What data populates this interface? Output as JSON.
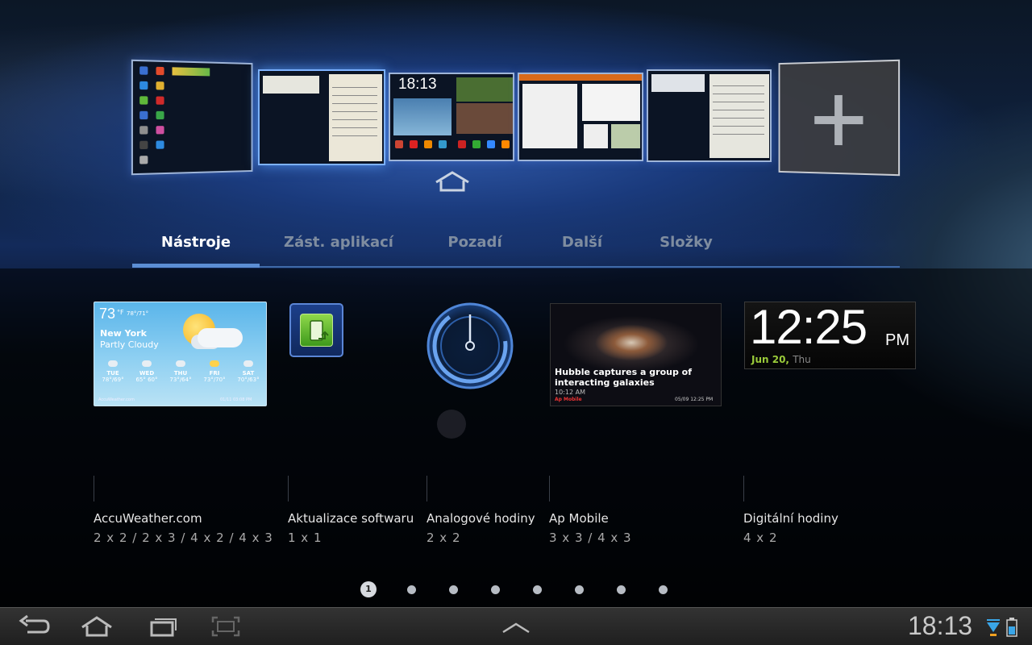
{
  "home_screens": {
    "count": 5,
    "active_index": 1,
    "mini_clock": "18:13",
    "add_icon": "plus-icon"
  },
  "tabs": [
    {
      "label": "Nástroje",
      "active": true
    },
    {
      "label": "Zást. aplikací",
      "active": false
    },
    {
      "label": "Pozadí",
      "active": false
    },
    {
      "label": "Další",
      "active": false
    },
    {
      "label": "Složky",
      "active": false
    }
  ],
  "widgets": {
    "accuweather": {
      "name": "AccuWeather.com",
      "sizes": "2 x 2 / 2 x 3 / 4 x 2 / 4 x 3",
      "temp": "73",
      "unit": "°F",
      "hilo": "78°/71°",
      "city": "New York",
      "condition": "Partly Cloudy",
      "days": [
        {
          "day": "TUE",
          "range": "78°/69°"
        },
        {
          "day": "WED",
          "range": "65° 60°"
        },
        {
          "day": "THU",
          "range": "73°/64°"
        },
        {
          "day": "FRI",
          "range": "73°/70°"
        },
        {
          "day": "SAT",
          "range": "70°/63°"
        }
      ],
      "footer_left": "AccuWeather.com",
      "footer_right": "01/11 03:08 PM"
    },
    "software_update": {
      "name": "Aktualizace softwaru",
      "sizes": "1 x 1"
    },
    "analog_clock": {
      "name": "Analogové hodiny",
      "sizes": "2 x 2"
    },
    "ap_mobile": {
      "name": "Ap Mobile",
      "sizes": "3 x 3 / 4 x 3",
      "headline": "Hubble captures a group of interacting galaxies",
      "time": "10:12 AM",
      "brand": "Ap Mobile",
      "stamp": "05/09 12:25 PM"
    },
    "digital_clock": {
      "name": "Digitální hodiny",
      "sizes": "4 x 2",
      "time": "12:25",
      "ampm": "PM",
      "date": "Jun 20,",
      "dow": "Thu"
    }
  },
  "pager": {
    "current": "1",
    "total": 8
  },
  "system_bar": {
    "clock": "18:13",
    "buttons": [
      "back-icon",
      "home-icon",
      "recent-apps-icon",
      "screenshot-icon"
    ],
    "up_icon": "chevron-up-icon"
  },
  "colors": {
    "accent": "#5c8ed4",
    "date_green": "#9acb3a"
  }
}
